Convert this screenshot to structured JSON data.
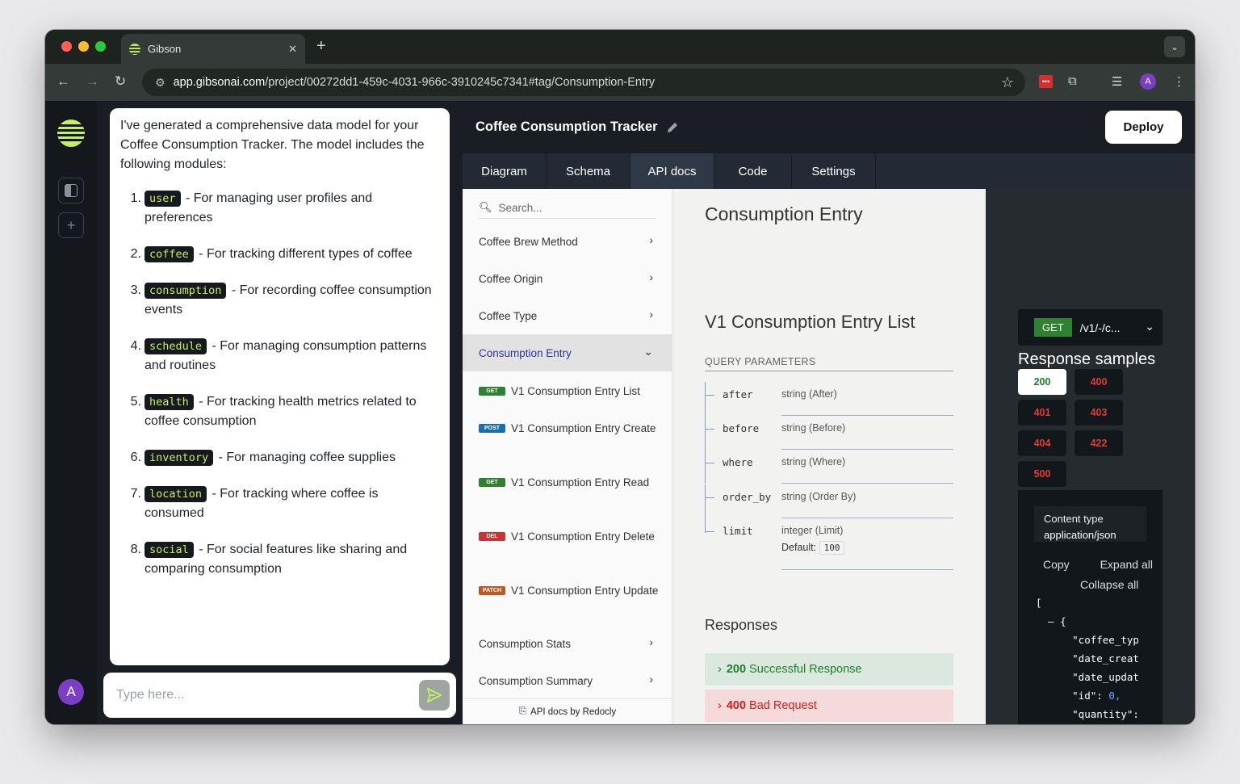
{
  "browser": {
    "tab_title": "Gibson",
    "url_host": "app.gibsonai.com",
    "url_path": "/project/00272dd1-459c-4031-966c-3910245c7341#tag/Consumption-Entry",
    "profile_initial": "A"
  },
  "rail": {
    "user_initial": "A"
  },
  "chat": {
    "intro": "I've generated a comprehensive data model for your Coffee Consumption Tracker. The model includes the following modules:",
    "modules": [
      {
        "num": "1.",
        "tag": "user",
        "text": " - For managing user profiles and preferences"
      },
      {
        "num": "2.",
        "tag": "coffee",
        "text": " - For tracking different types of coffee"
      },
      {
        "num": "3.",
        "tag": "consumption",
        "text": " - For recording coffee consumption events"
      },
      {
        "num": "4.",
        "tag": "schedule",
        "text": " - For managing consumption patterns and routines"
      },
      {
        "num": "5.",
        "tag": "health",
        "text": " - For tracking health metrics related to coffee consumption"
      },
      {
        "num": "6.",
        "tag": "inventory",
        "text": " - For managing coffee supplies"
      },
      {
        "num": "7.",
        "tag": "location",
        "text": " - For tracking where coffee is consumed"
      },
      {
        "num": "8.",
        "tag": "social",
        "text": " - For social features like sharing and comparing consumption"
      }
    ],
    "input_placeholder": "Type here..."
  },
  "project": {
    "title": "Coffee Consumption Tracker",
    "deploy_label": "Deploy",
    "tabs": [
      "Diagram",
      "Schema",
      "API docs",
      "Code",
      "Settings"
    ],
    "active_tab": "API docs"
  },
  "redoc": {
    "search_placeholder": "Search...",
    "menu": [
      "Coffee Brew Method",
      "Coffee Origin",
      "Coffee Type",
      "Consumption Entry",
      "Consumption Stats",
      "Consumption Summary"
    ],
    "operations": [
      {
        "method": "GET",
        "label": "V1 Consumption Entry List",
        "color": "#2f8132"
      },
      {
        "method": "POST",
        "label": "V1 Consumption Entry Create",
        "color": "#186fb0"
      },
      {
        "method": "GET",
        "label": "V1 Consumption Entry Read",
        "color": "#2f8132"
      },
      {
        "method": "DEL",
        "label": "V1 Consumption Entry Delete",
        "color": "#cc3333"
      },
      {
        "method": "PATCH",
        "label": "V1 Consumption Entry Update",
        "color": "#bf581d"
      }
    ],
    "footer": "API docs by Redocly",
    "section_title": "Consumption Entry",
    "operation_title": "V1 Consumption Entry List",
    "query_heading": "QUERY PARAMETERS",
    "params": [
      {
        "name": "after",
        "type": "string (After)"
      },
      {
        "name": "before",
        "type": "string (Before)"
      },
      {
        "name": "where",
        "type": "string (Where)"
      },
      {
        "name": "order_by",
        "type": "string (Order By)"
      },
      {
        "name": "limit",
        "type": "integer (Limit)",
        "default_label": "Default:",
        "default_value": "100"
      }
    ],
    "responses_heading": "Responses",
    "responses": [
      {
        "code": "200",
        "text": "Successful Response"
      },
      {
        "code": "400",
        "text": "Bad Request"
      }
    ]
  },
  "samples": {
    "method": "GET",
    "path": "/v1/-/c...",
    "title": "Response samples",
    "codes": [
      "200",
      "400",
      "401",
      "403",
      "404",
      "422",
      "500"
    ],
    "content_type_label": "Content type",
    "content_type": "application/json",
    "copy": "Copy",
    "expand": "Expand all",
    "collapse": "Collapse all",
    "json_lines": [
      "[",
      "  – {",
      "      \"coffee_typ",
      "      \"date_creat",
      "      \"date_updat",
      "      \"id\": ",
      "      \"quantity\":"
    ],
    "json_id_value": "0,"
  }
}
